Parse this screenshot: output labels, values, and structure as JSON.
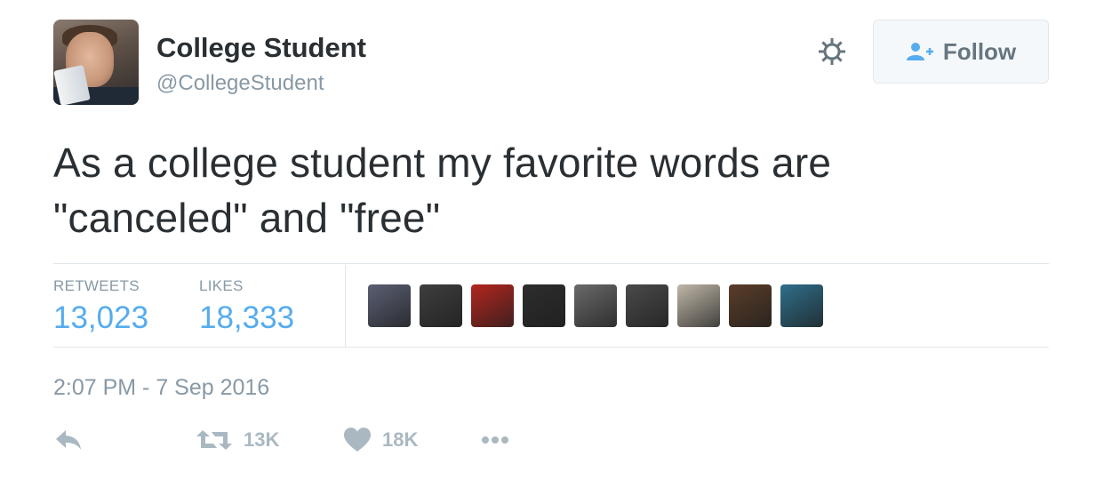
{
  "user": {
    "name": "College Student",
    "handle": "@CollegeStudent"
  },
  "follow_button": {
    "label": "Follow"
  },
  "tweet": {
    "text_line1": "As a college student my favorite words are",
    "text_line2": "\"canceled\" and \"free\""
  },
  "stats": {
    "retweets_label": "RETWEETS",
    "retweets_value": "13,023",
    "likes_label": "LIKES",
    "likes_value": "18,333"
  },
  "likers": [
    {
      "color": "#5b5f73"
    },
    {
      "color": "#3e3e3e"
    },
    {
      "color": "#b3261e"
    },
    {
      "color": "#2d2d2d"
    },
    {
      "color": "#6a6a6a"
    },
    {
      "color": "#4a4a4a"
    },
    {
      "color": "#bfb7a8"
    },
    {
      "color": "#5a3d28"
    },
    {
      "color": "#2f6f8a"
    }
  ],
  "timestamp": "2:07 PM - 7 Sep 2016",
  "actions": {
    "reply_icon": "reply-icon",
    "retweet_count": "13K",
    "like_count": "18K",
    "more_icon": "more-icon"
  },
  "colors": {
    "accent": "#55acee",
    "muted": "#8899a6",
    "action": "#aab8c2"
  }
}
